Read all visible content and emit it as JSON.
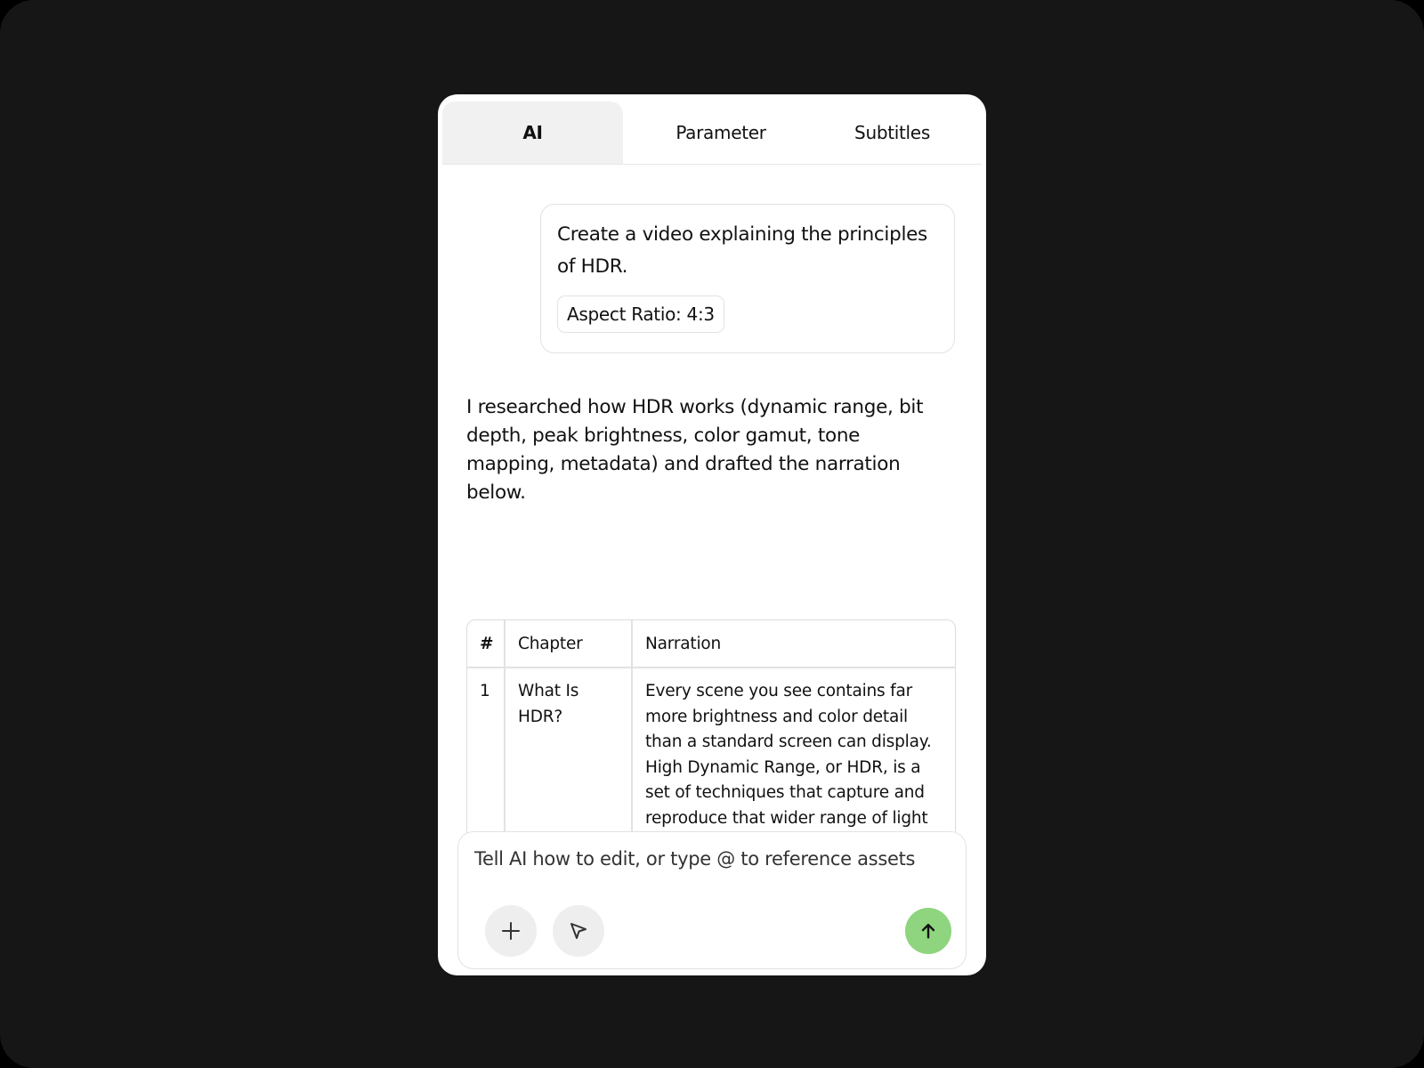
{
  "tabs": [
    {
      "label": "AI",
      "active": true
    },
    {
      "label": "Parameter",
      "active": false
    },
    {
      "label": "Subtitles",
      "active": false
    }
  ],
  "user_message": {
    "text": "Create a video explaining the principles of HDR.",
    "chip": "Aspect Ratio: 4:3"
  },
  "ai_message": {
    "text": "I researched how HDR works (dynamic range, bit depth, peak brightness, color gamut, tone mapping, metadata) and drafted the narration below."
  },
  "table": {
    "headers": [
      "#",
      "Chapter",
      "Narration"
    ],
    "rows": [
      {
        "num": "1",
        "chapter": "What Is HDR?",
        "narration": "Every scene you see contains far more brightness and color detail than a standard screen can display. High Dynamic Range, or HDR, is a set of techniques that capture and reproduce that wider range of light and color. The result is an image that looks closer to what your eyes actually perceive in the real world."
      }
    ]
  },
  "composer": {
    "placeholder": "Tell AI how to edit, or type @ to reference assets",
    "add_icon": "plus-icon",
    "pointer_icon": "cursor-arrow-icon",
    "send_icon": "arrow-up-icon",
    "send_color": "#8fd47e"
  }
}
